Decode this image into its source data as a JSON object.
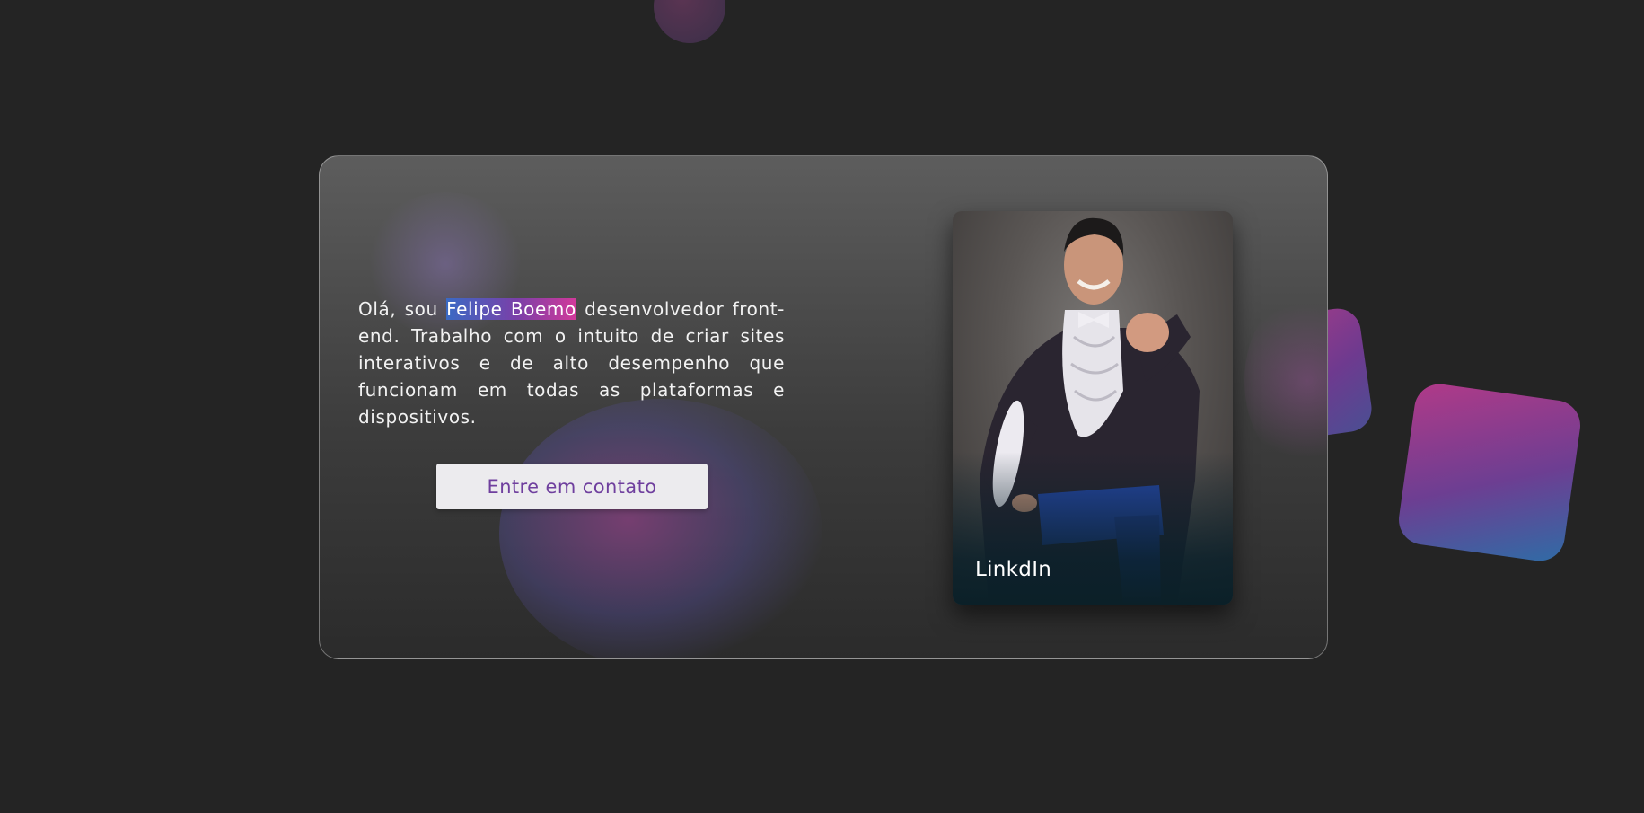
{
  "hero": {
    "intro_before": "Olá, sou ",
    "name": "Felipe Boemo",
    "intro_after": " desenvolvedor front-end. Trabalho com o intuito de criar sites interativos e de alto desempenho que funcionam em todas as plataformas e dispositivos.",
    "cta_label": "Entre em contato"
  },
  "profile_card": {
    "link_label": "LinkdIn",
    "photo_description_icon": "person-photo"
  },
  "colors": {
    "background": "#242424",
    "accent_purple": "#6f3f9e",
    "accent_pink": "#d2399a",
    "accent_blue": "#3a6ac4",
    "button_bg": "#ecebee"
  }
}
